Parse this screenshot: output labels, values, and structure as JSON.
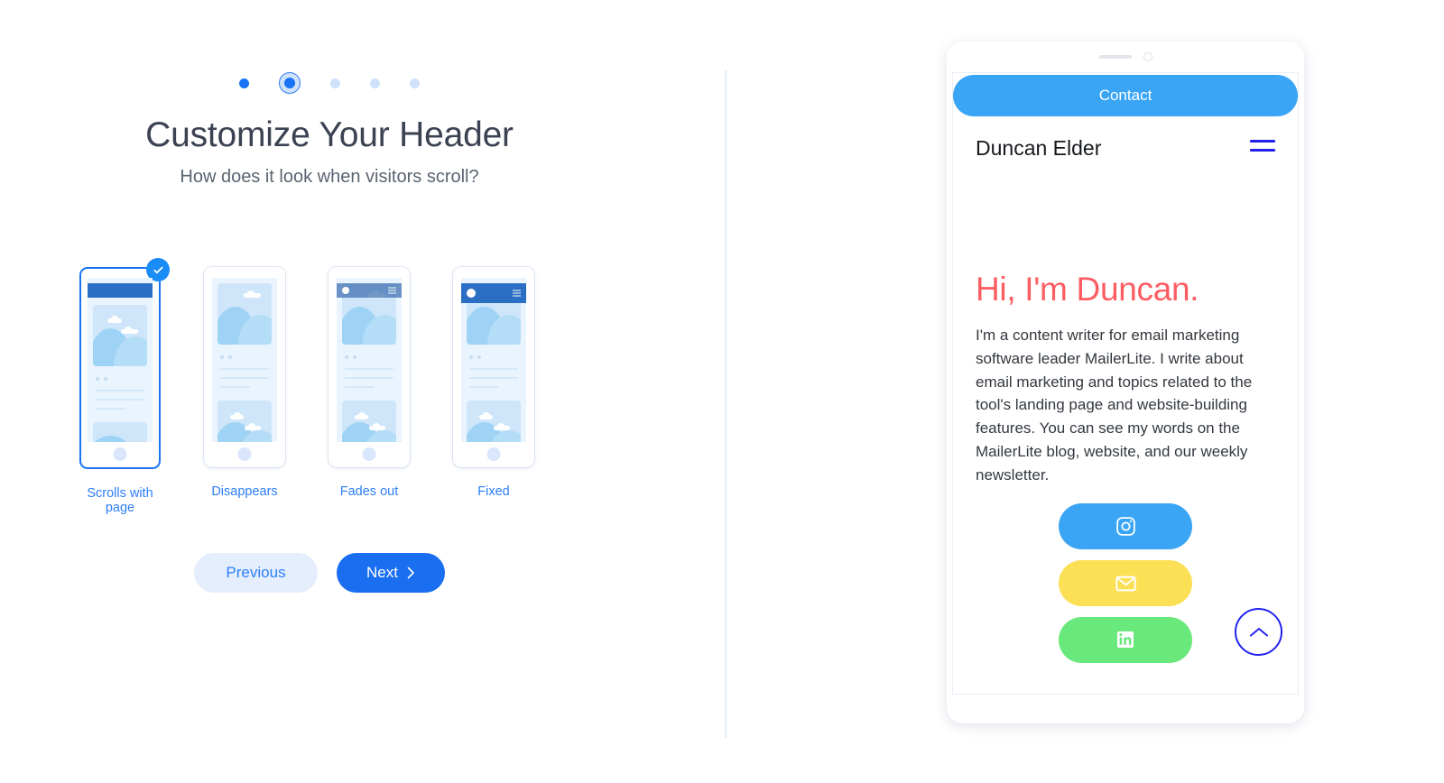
{
  "wizard": {
    "title": "Customize Your Header",
    "subtitle": "How does it look when visitors scroll?",
    "steps": [
      {
        "state": "done"
      },
      {
        "state": "active"
      },
      {
        "state": "upcoming"
      },
      {
        "state": "upcoming"
      },
      {
        "state": "upcoming"
      }
    ],
    "total_steps": 5,
    "current_step": 2,
    "options": [
      {
        "label": "Scrolls with page",
        "selected": true,
        "header_style": "scrolls"
      },
      {
        "label": "Disappears",
        "selected": false,
        "header_style": "none"
      },
      {
        "label": "Fades out",
        "selected": false,
        "header_style": "translucent"
      },
      {
        "label": "Fixed",
        "selected": false,
        "header_style": "solid"
      }
    ],
    "buttons": {
      "previous_label": "Previous",
      "next_label": "Next",
      "next_icon": "chevron-right-icon"
    },
    "selected_badge_icon": "check-circle-icon"
  },
  "preview": {
    "device": "tablet",
    "contact_banner_label": "Contact",
    "site_name": "Duncan Elder",
    "menu_icon": "hamburger-menu-icon",
    "heading": "Hi, I'm Duncan.",
    "body": "I'm a content writer for email marketing software leader MailerLite. I write about email marketing and topics related to the tool's landing page and website-building features. You can see my words on the MailerLite blog, website, and our weekly newsletter.",
    "social_buttons": [
      {
        "name": "instagram",
        "icon": "instagram-icon",
        "color": "#3aa5f5"
      },
      {
        "name": "email",
        "icon": "envelope-icon",
        "color": "#fbe055"
      },
      {
        "name": "linkedin",
        "icon": "linkedin-icon",
        "color": "#69e87c"
      }
    ],
    "scroll_top_icon": "chevron-up-icon"
  },
  "colors": {
    "accent_blue": "#1a73f5",
    "link_blue": "#2d7ef7",
    "banner_blue": "#3aa5f5",
    "heading_red": "#fc5d63",
    "yellow": "#fbe055",
    "green": "#69e87c",
    "menu_blue": "#2222ee"
  }
}
